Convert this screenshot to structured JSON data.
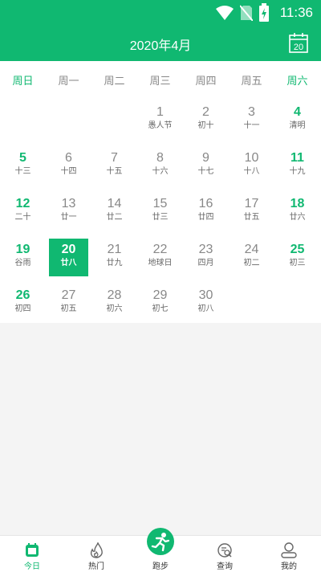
{
  "status_bar": {
    "time": "11:36",
    "icons": [
      "wifi-icon",
      "no-sim-icon",
      "battery-charging-icon"
    ]
  },
  "header": {
    "title": "2020年4月",
    "today_button": "20",
    "colors": {
      "bg": "#10b871",
      "text": "#ffffff"
    }
  },
  "weekdays": [
    "周日",
    "周一",
    "周二",
    "周三",
    "周四",
    "周五",
    "周六"
  ],
  "selected_date": "20",
  "weeks": [
    [
      null,
      null,
      null,
      {
        "d": "1",
        "l": "愚人节"
      },
      {
        "d": "2",
        "l": "初十"
      },
      {
        "d": "3",
        "l": "十一"
      },
      {
        "d": "4",
        "l": "清明"
      }
    ],
    [
      {
        "d": "5",
        "l": "十三"
      },
      {
        "d": "6",
        "l": "十四"
      },
      {
        "d": "7",
        "l": "十五"
      },
      {
        "d": "8",
        "l": "十六"
      },
      {
        "d": "9",
        "l": "十七"
      },
      {
        "d": "10",
        "l": "十八"
      },
      {
        "d": "11",
        "l": "十九"
      }
    ],
    [
      {
        "d": "12",
        "l": "二十"
      },
      {
        "d": "13",
        "l": "廿一"
      },
      {
        "d": "14",
        "l": "廿二"
      },
      {
        "d": "15",
        "l": "廿三"
      },
      {
        "d": "16",
        "l": "廿四"
      },
      {
        "d": "17",
        "l": "廿五"
      },
      {
        "d": "18",
        "l": "廿六"
      }
    ],
    [
      {
        "d": "19",
        "l": "谷雨"
      },
      {
        "d": "20",
        "l": "廿八"
      },
      {
        "d": "21",
        "l": "廿九"
      },
      {
        "d": "22",
        "l": "地球日"
      },
      {
        "d": "23",
        "l": "四月"
      },
      {
        "d": "24",
        "l": "初二"
      },
      {
        "d": "25",
        "l": "初三"
      }
    ],
    [
      {
        "d": "26",
        "l": "初四"
      },
      {
        "d": "27",
        "l": "初五"
      },
      {
        "d": "28",
        "l": "初六"
      },
      {
        "d": "29",
        "l": "初七"
      },
      {
        "d": "30",
        "l": "初八"
      },
      null,
      null
    ]
  ],
  "bottom_nav": [
    {
      "label": "今日",
      "icon": "calendar-icon",
      "active": true
    },
    {
      "label": "热门",
      "icon": "fire-icon",
      "active": false
    },
    {
      "label": "跑步",
      "icon": "runner-icon",
      "active": false
    },
    {
      "label": "查询",
      "icon": "search-doc-icon",
      "active": false
    },
    {
      "label": "我的",
      "icon": "user-icon",
      "active": false
    }
  ],
  "accent_color": "#10b871"
}
